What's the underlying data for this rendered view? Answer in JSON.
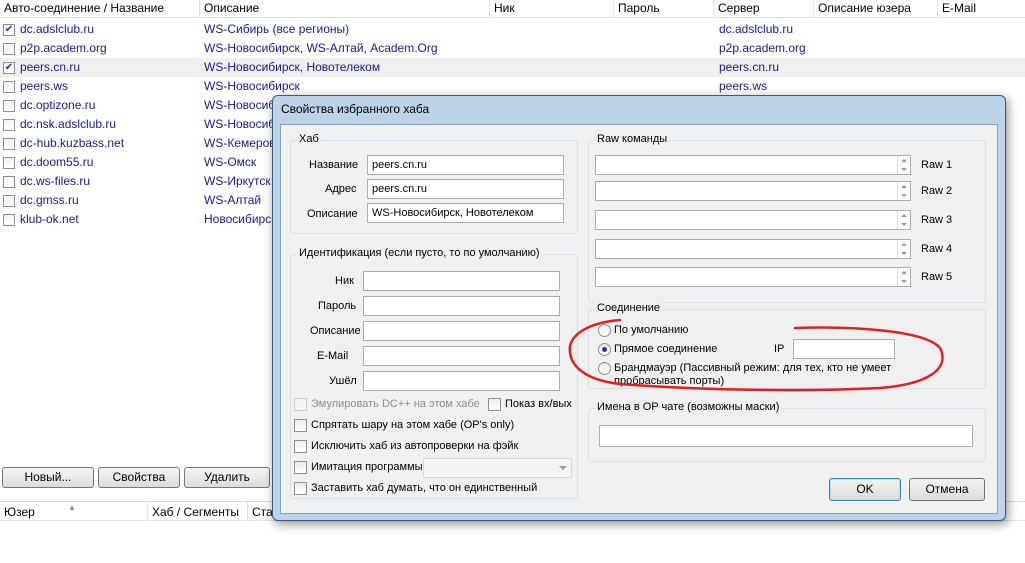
{
  "columns": [
    {
      "label": "Авто-соединение / Название"
    },
    {
      "label": "Описание"
    },
    {
      "label": "Ник"
    },
    {
      "label": "Пароль"
    },
    {
      "label": "Сервер"
    },
    {
      "label": "Описание юзера"
    },
    {
      "label": "E-Mail"
    }
  ],
  "hubs": [
    {
      "checked": true,
      "name": "dc.adslclub.ru",
      "desc": "WS-Сибирь (все регионы)",
      "server": "dc.adslclub.ru"
    },
    {
      "checked": false,
      "name": "p2p.academ.org",
      "desc": "WS-Новосибирск, WS-Алтай, Academ.Org",
      "server": "p2p.academ.org"
    },
    {
      "checked": true,
      "name": "peers.cn.ru",
      "desc": "WS-Новосибирск, Новотелеком",
      "server": "peers.cn.ru"
    },
    {
      "checked": false,
      "name": "peers.ws",
      "desc": "WS-Новосибирск",
      "server": "peers.ws"
    },
    {
      "checked": false,
      "name": "dc.optizone.ru",
      "desc": "WS-Новосиб",
      "server": ""
    },
    {
      "checked": false,
      "name": "dc.nsk.adslclub.ru",
      "desc": "WS-Новосиб",
      "server": ""
    },
    {
      "checked": false,
      "name": "dc-hub.kuzbass.net",
      "desc": "WS-Кемерово",
      "server": ""
    },
    {
      "checked": false,
      "name": "dc.doom55.ru",
      "desc": "WS-Омск",
      "server": ""
    },
    {
      "checked": false,
      "name": "dc.ws-files.ru",
      "desc": "WS-Иркутск",
      "server": ""
    },
    {
      "checked": false,
      "name": "dc.gmss.ru",
      "desc": "WS-Алтай",
      "server": ""
    },
    {
      "checked": false,
      "name": "klub-ok.net",
      "desc": "Новосибирск",
      "server": ""
    }
  ],
  "bottom_buttons": {
    "new": "Новый...",
    "props": "Свойства",
    "delete": "Удалить"
  },
  "users_columns": [
    {
      "label": "Юзер"
    },
    {
      "label": "Хаб / Сегменты"
    },
    {
      "label": "Ста"
    }
  ],
  "dialog": {
    "title": "Свойства избранного хаба",
    "hub_group": "Хаб",
    "name_label": "Название",
    "name_value": "peers.cn.ru",
    "address_label": "Адрес",
    "address_value": "peers.cn.ru",
    "desc_label": "Описание",
    "desc_value": "WS-Новосибирск, Новотелеком",
    "ident_group": "Идентификация (если пусто, то по умолчанию)",
    "nick_label": "Ник",
    "password_label": "Пароль",
    "user_desc_label": "Описание",
    "email_label": "E-Mail",
    "away_label": "Ушёл",
    "emulate_dc": "Эмулировать DC++ на этом хабе",
    "show_joins": "Показ вх/вых",
    "hide_share": "Спрятать шару на этом хабе (OP's only)",
    "exclude_check": "Исключить хаб из автопроверки на фэйк",
    "emulate_client": "Имитация программы",
    "only_hub": "Заставить хаб думать, что он единственный",
    "raw_group": "Raw команды",
    "raw_labels": [
      "Raw 1",
      "Raw 2",
      "Raw 3",
      "Raw 4",
      "Raw 5"
    ],
    "conn_group": "Соединение",
    "conn_default": "По умолчанию",
    "conn_direct": "Прямое соединение",
    "ip_label": "IP",
    "conn_firewall": "Брандмауэр (Пассивный режим: для тех, кто не умеет пробрасывать порты)",
    "op_group": "Имена в OP чате (возможны маски)",
    "ok": "OK",
    "cancel": "Отмена"
  },
  "colors": {
    "link": "#1a1a8a",
    "annotation": "#e02020",
    "dialog_frame": "#bcd3ea"
  }
}
